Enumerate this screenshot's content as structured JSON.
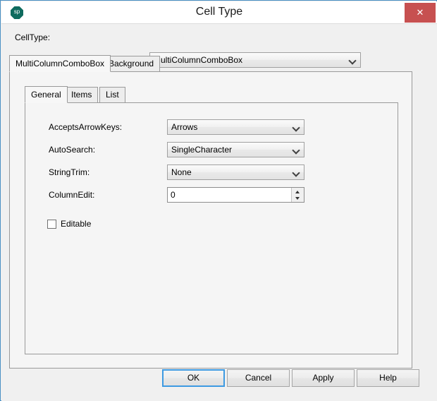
{
  "window": {
    "title": "Cell Type",
    "icon_label": "sp",
    "icon_name": "spreadsheet-app-icon",
    "close_label": "✕",
    "accent_border": "#4a90c4",
    "close_color": "#c75050",
    "focus_color": "#3d9ae2"
  },
  "celltype": {
    "label": "CellType:",
    "value": "MultiColumnComboBox"
  },
  "outer_tabs": [
    {
      "label": "MultiColumnComboBox",
      "selected": true
    },
    {
      "label": "Background",
      "selected": false
    }
  ],
  "inner_tabs": [
    {
      "label": "General",
      "selected": true
    },
    {
      "label": "Items",
      "selected": false
    },
    {
      "label": "List",
      "selected": false
    }
  ],
  "general": {
    "fields": [
      {
        "label": "AcceptsArrowKeys:",
        "value": "Arrows",
        "type": "combobox"
      },
      {
        "label": "AutoSearch:",
        "value": "SingleCharacter",
        "type": "combobox"
      },
      {
        "label": "StringTrim:",
        "value": "None",
        "type": "combobox"
      },
      {
        "label": "ColumnEdit:",
        "value": "0",
        "type": "spinner"
      }
    ],
    "editable": {
      "label": "Editable",
      "checked": false
    }
  },
  "buttons": {
    "ok": "OK",
    "cancel": "Cancel",
    "apply": "Apply",
    "help": "Help"
  }
}
